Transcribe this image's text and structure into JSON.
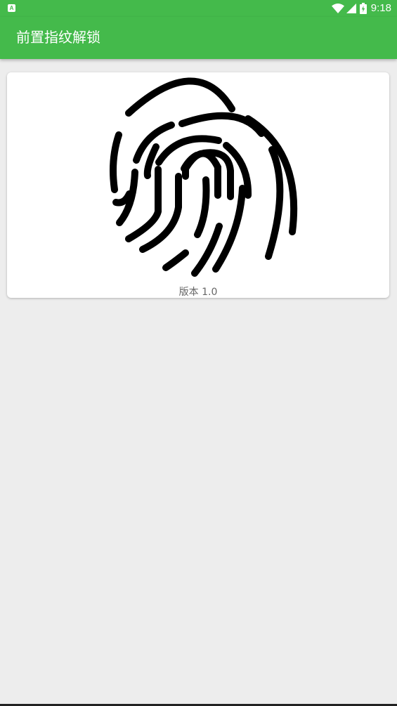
{
  "status_bar": {
    "notification_icon": "A",
    "time": "9:18",
    "icons": [
      "wifi-icon",
      "cell-signal-icon",
      "battery-icon"
    ]
  },
  "app_bar": {
    "title": "前置指纹解锁",
    "background_color": "#44ba4b"
  },
  "card": {
    "image": "fingerprint-icon",
    "version_label": "版本 1.0"
  }
}
